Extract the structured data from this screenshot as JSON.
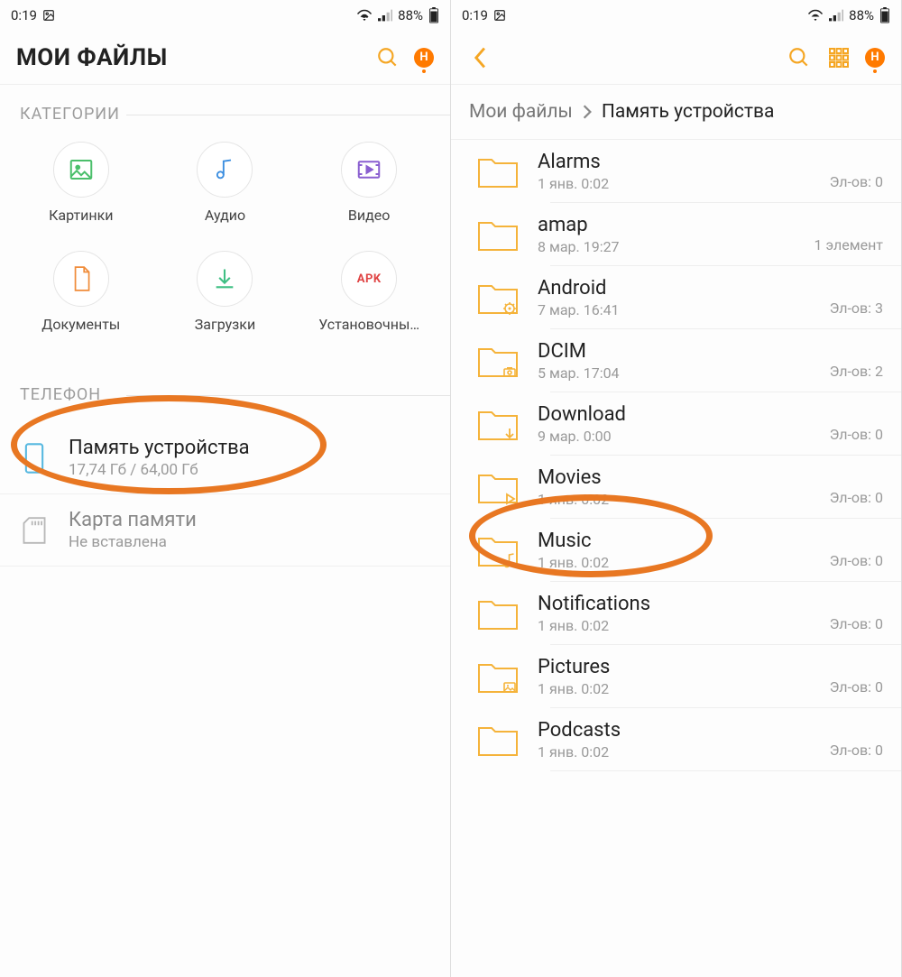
{
  "status": {
    "time": "0:19",
    "battery_pct": "88%"
  },
  "left": {
    "title": "МОИ ФАЙЛЫ",
    "badge_letter": "H",
    "section_categories": "КАТЕГОРИИ",
    "section_phone": "ТЕЛЕФОН",
    "categories": [
      {
        "label": "Картинки",
        "icon": "image",
        "color": "#4bbf6b"
      },
      {
        "label": "Аудио",
        "icon": "audio",
        "color": "#3a8de0"
      },
      {
        "label": "Видео",
        "icon": "video",
        "color": "#8a5fd0"
      },
      {
        "label": "Документы",
        "icon": "document",
        "color": "#f08c3a"
      },
      {
        "label": "Загрузки",
        "icon": "download",
        "color": "#3fbf84"
      },
      {
        "label": "Установочны…",
        "icon": "apk",
        "color": "#e04545"
      }
    ],
    "storage": [
      {
        "title": "Память устройства",
        "sub": "17,74 Гб / 64,00 Гб",
        "icon": "phone"
      },
      {
        "title": "Карта памяти",
        "sub": "Не вставлена",
        "icon": "sd"
      }
    ]
  },
  "right": {
    "badge_letter": "H",
    "breadcrumb_root": "Мои файлы",
    "breadcrumb_current": "Память устройства",
    "folders": [
      {
        "name": "Alarms",
        "date": "1 янв. 0:02",
        "count": "Эл-ов: 0",
        "special": ""
      },
      {
        "name": "amap",
        "date": "8 мар. 19:27",
        "count": "1 элемент",
        "special": ""
      },
      {
        "name": "Android",
        "date": "7 мар. 16:41",
        "count": "Эл-ов: 3",
        "special": "gear"
      },
      {
        "name": "DCIM",
        "date": "5 мар. 17:04",
        "count": "Эл-ов: 2",
        "special": "camera"
      },
      {
        "name": "Download",
        "date": "9 мар. 0:00",
        "count": "Эл-ов: 0",
        "special": "download"
      },
      {
        "name": "Movies",
        "date": "1 янв. 0:02",
        "count": "Эл-ов: 0",
        "special": "play"
      },
      {
        "name": "Music",
        "date": "1 янв. 0:02",
        "count": "Эл-ов: 0",
        "special": "music"
      },
      {
        "name": "Notifications",
        "date": "1 янв. 0:02",
        "count": "Эл-ов: 0",
        "special": ""
      },
      {
        "name": "Pictures",
        "date": "1 янв. 0:02",
        "count": "Эл-ов: 0",
        "special": "image"
      },
      {
        "name": "Podcasts",
        "date": "1 янв. 0:02",
        "count": "Эл-ов: 0",
        "special": ""
      }
    ]
  }
}
